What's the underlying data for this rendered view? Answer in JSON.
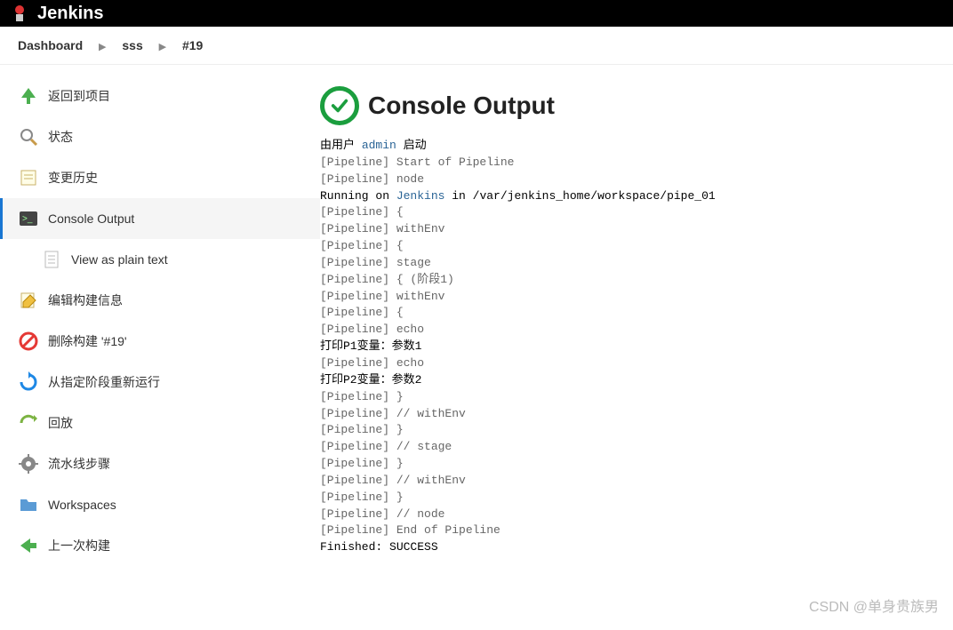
{
  "header": {
    "brand": "Jenkins"
  },
  "breadcrumbs": {
    "items": [
      "Dashboard",
      "sss",
      "#19"
    ]
  },
  "sidebar": {
    "items": [
      {
        "id": "back",
        "label": "返回到项目"
      },
      {
        "id": "status",
        "label": "状态"
      },
      {
        "id": "changes",
        "label": "变更历史"
      },
      {
        "id": "console",
        "label": "Console Output"
      },
      {
        "id": "plaintext",
        "label": "View as plain text"
      },
      {
        "id": "edit",
        "label": "编辑构建信息"
      },
      {
        "id": "delete",
        "label": "删除构建 '#19'"
      },
      {
        "id": "restart",
        "label": "从指定阶段重新运行"
      },
      {
        "id": "replay",
        "label": "回放"
      },
      {
        "id": "steps",
        "label": "流水线步骤"
      },
      {
        "id": "workspaces",
        "label": "Workspaces"
      },
      {
        "id": "prev",
        "label": "上一次构建"
      }
    ]
  },
  "page": {
    "title": "Console Output",
    "start_prefix": "由用户 ",
    "start_user": "admin",
    "start_suffix": " 启动",
    "running_prefix": "Running on ",
    "running_node": "Jenkins",
    "running_suffix": " in /var/jenkins_home/workspace/pipe_01",
    "lines": {
      "l1": "[Pipeline] Start of Pipeline",
      "l2": "[Pipeline] node",
      "l3": "[Pipeline] {",
      "l4": "[Pipeline] withEnv",
      "l5": "[Pipeline] {",
      "l6": "[Pipeline] stage",
      "l7": "[Pipeline] { (阶段1)",
      "l8": "[Pipeline] withEnv",
      "l9": "[Pipeline] {",
      "l10": "[Pipeline] echo",
      "l11": "打印P1变量：参数1",
      "l12": "[Pipeline] echo",
      "l13": "打印P2变量：参数2",
      "l14": "[Pipeline] }",
      "l15": "[Pipeline] // withEnv",
      "l16": "[Pipeline] }",
      "l17": "[Pipeline] // stage",
      "l18": "[Pipeline] }",
      "l19": "[Pipeline] // withEnv",
      "l20": "[Pipeline] }",
      "l21": "[Pipeline] // node",
      "l22": "[Pipeline] End of Pipeline",
      "l23": "Finished: SUCCESS"
    }
  },
  "watermark": "CSDN @单身贵族男"
}
